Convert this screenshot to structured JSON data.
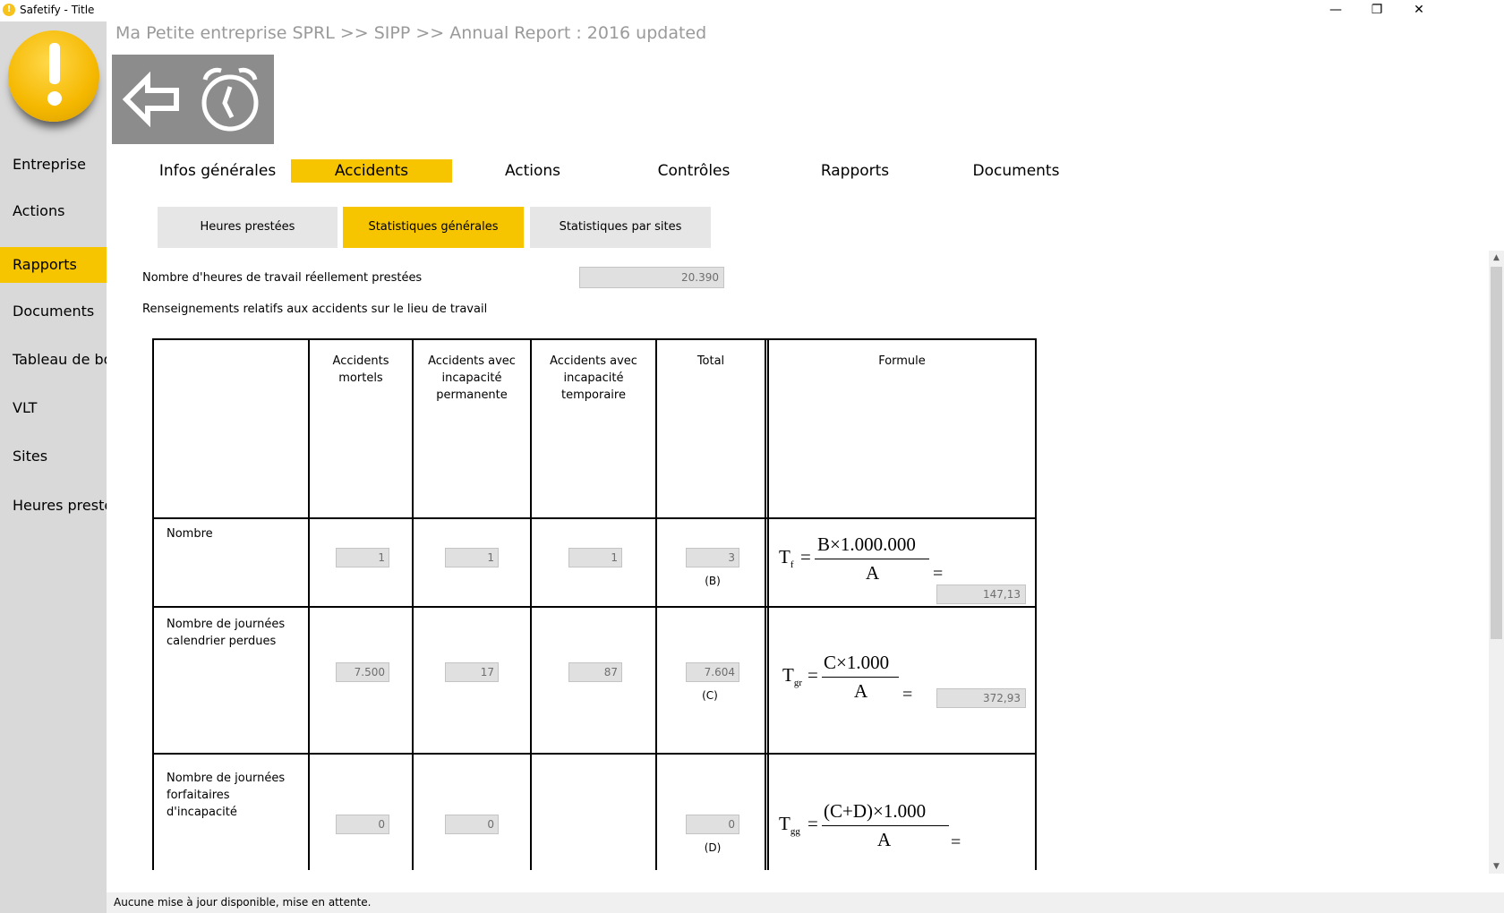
{
  "window": {
    "title": "Safetify - Title",
    "min_glyph": "—",
    "restore_glyph": "❐",
    "close_glyph": "✕"
  },
  "breadcrumb": "Ma Petite entreprise SPRL >> SIPP >> Annual Report : 2016 updated",
  "sidebar": {
    "items": [
      {
        "label": "Entreprise",
        "active": false
      },
      {
        "label": "Actions",
        "active": false
      },
      {
        "label": "Rapports",
        "active": true
      },
      {
        "label": "Documents",
        "active": false
      },
      {
        "label": "Tableau de bord",
        "active": false
      },
      {
        "label": "VLT",
        "active": false
      },
      {
        "label": "Sites",
        "active": false
      },
      {
        "label": "Heures prestées",
        "active": false
      }
    ]
  },
  "tabs": [
    {
      "label": "Infos générales"
    },
    {
      "label": "Accidents"
    },
    {
      "label": "Actions"
    },
    {
      "label": "Contrôles"
    },
    {
      "label": "Rapports"
    },
    {
      "label": "Documents"
    }
  ],
  "subtabs": [
    {
      "label": "Heures prestées"
    },
    {
      "label": "Statistiques générales"
    },
    {
      "label": "Statistiques par sites"
    }
  ],
  "hours": {
    "label": "Nombre d'heures de travail réellement prestées",
    "value": "20.390"
  },
  "info_label": "Renseignements relatifs aux accidents sur le lieu de travail",
  "table": {
    "headers": {
      "mortels": "Accidents mortels",
      "permanente": "Accidents avec incapacité permanente",
      "temporaire": "Accidents avec incapacité temporaire",
      "total": "Total",
      "formule": "Formule"
    },
    "row1": {
      "label": "Nombre",
      "mortels": "1",
      "permanente": "1",
      "temporaire": "1",
      "total": "3",
      "total_sub": "(B)",
      "result": "147,13"
    },
    "row2": {
      "label": "Nombre de journées calendrier perdues",
      "mortels": "7.500",
      "permanente": "17",
      "temporaire": "87",
      "total": "7.604",
      "total_sub": "(C)",
      "result": "372,93"
    },
    "row3": {
      "label": "Nombre de journées forfaitaires d'incapacité",
      "mortels": "0",
      "permanente": "0",
      "total": "0",
      "total_sub": "(D)"
    }
  },
  "formulas": {
    "f1": {
      "lhs": "T",
      "lhs_sub": "f",
      "num": "B×1.000.000",
      "den": "A",
      "eq": "="
    },
    "f2": {
      "lhs": "T",
      "lhs_sub": "gr",
      "num": "C×1.000",
      "den": "A",
      "eq": "="
    },
    "f3": {
      "lhs": "T",
      "lhs_sub": "gg",
      "num": "(C+D)×1.000",
      "den": "A",
      "eq": "="
    }
  },
  "scroll": {
    "up": "▲",
    "down": "▼"
  },
  "status": "Aucune mise à jour disponible, mise en attente.",
  "colors": {
    "accent": "#f7c500",
    "sidebar": "#d9d9d9",
    "toolbar": "#8c8c8c"
  }
}
